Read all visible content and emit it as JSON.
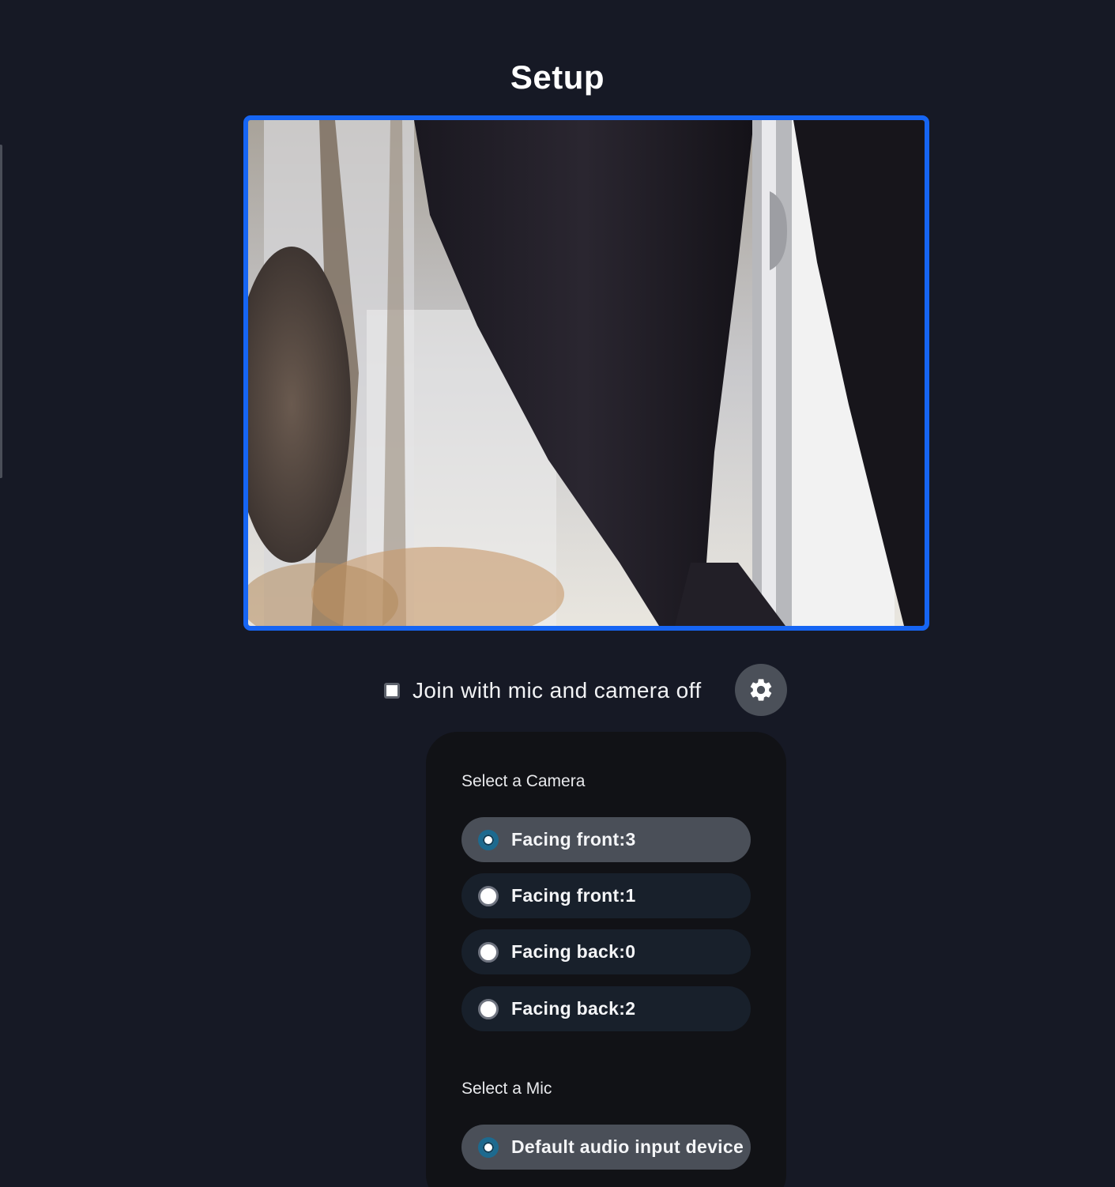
{
  "page": {
    "title": "Setup"
  },
  "preview": {
    "label": ""
  },
  "join": {
    "checkbox_label": "Join with mic and camera off",
    "checked": false
  },
  "settings": {
    "icon": "gear-icon"
  },
  "camera": {
    "heading": "Select a Camera",
    "options": [
      {
        "label": "Facing front:3",
        "selected": true
      },
      {
        "label": "Facing front:1",
        "selected": false
      },
      {
        "label": "Facing back:0",
        "selected": false
      },
      {
        "label": "Facing back:2",
        "selected": false
      }
    ]
  },
  "mic": {
    "heading": "Select a Mic",
    "options": [
      {
        "label": "Default audio input device",
        "selected": true
      }
    ]
  },
  "colors": {
    "background": "#161925",
    "accent": "#1665f3",
    "panel": "#111216",
    "option_selected": "#4a4f58",
    "option_default": "#18202b"
  }
}
